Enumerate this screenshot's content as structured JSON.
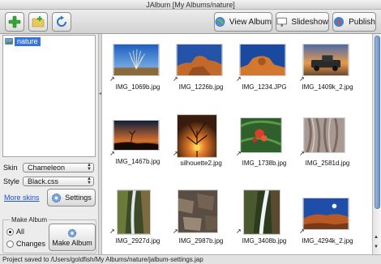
{
  "window": {
    "title": "JAlbum [My Albums/nature]"
  },
  "toolbar": {
    "view_album_label": "View Album",
    "slideshow_label": "Slideshow",
    "publish_label": "Publish",
    "icons": [
      "add-icon",
      "new-folder-icon",
      "refresh-icon"
    ]
  },
  "tree": {
    "root_label": "nature"
  },
  "settings": {
    "skin_label": "Skin",
    "skin_value": "Chameleon",
    "style_label": "Style",
    "style_value": "Black.css",
    "more_skins_label": "More skins",
    "settings_button_label": "Settings"
  },
  "make_album": {
    "group_title": "Make Album",
    "radio_all": "All",
    "radio_changes": "Changes",
    "selected": "All",
    "button_label": "Make Album"
  },
  "images": [
    {
      "name": "IMG_1069b.jpg"
    },
    {
      "name": "IMG_1226b.jpg"
    },
    {
      "name": "IMG_1234.JPG"
    },
    {
      "name": "IMG_1409k_2.jpg"
    },
    {
      "name": "IMG_1467b.jpg"
    },
    {
      "name": "silhouette2.jpg"
    },
    {
      "name": "IMG_1738b.jpg"
    },
    {
      "name": "IMG_2581d.jpg"
    },
    {
      "name": "IMG_2927d.jpg"
    },
    {
      "name": "IMG_2987b.jpg"
    },
    {
      "name": "IMG_3408b.jpg"
    },
    {
      "name": "IMG_4294k_2.jpg"
    }
  ],
  "status": {
    "text": "Project saved to /Users/goldfish/My Albums/nature/jalbum-settings.jap"
  },
  "colors": {
    "selection": "#3875d7",
    "link": "#1a4fd6"
  }
}
